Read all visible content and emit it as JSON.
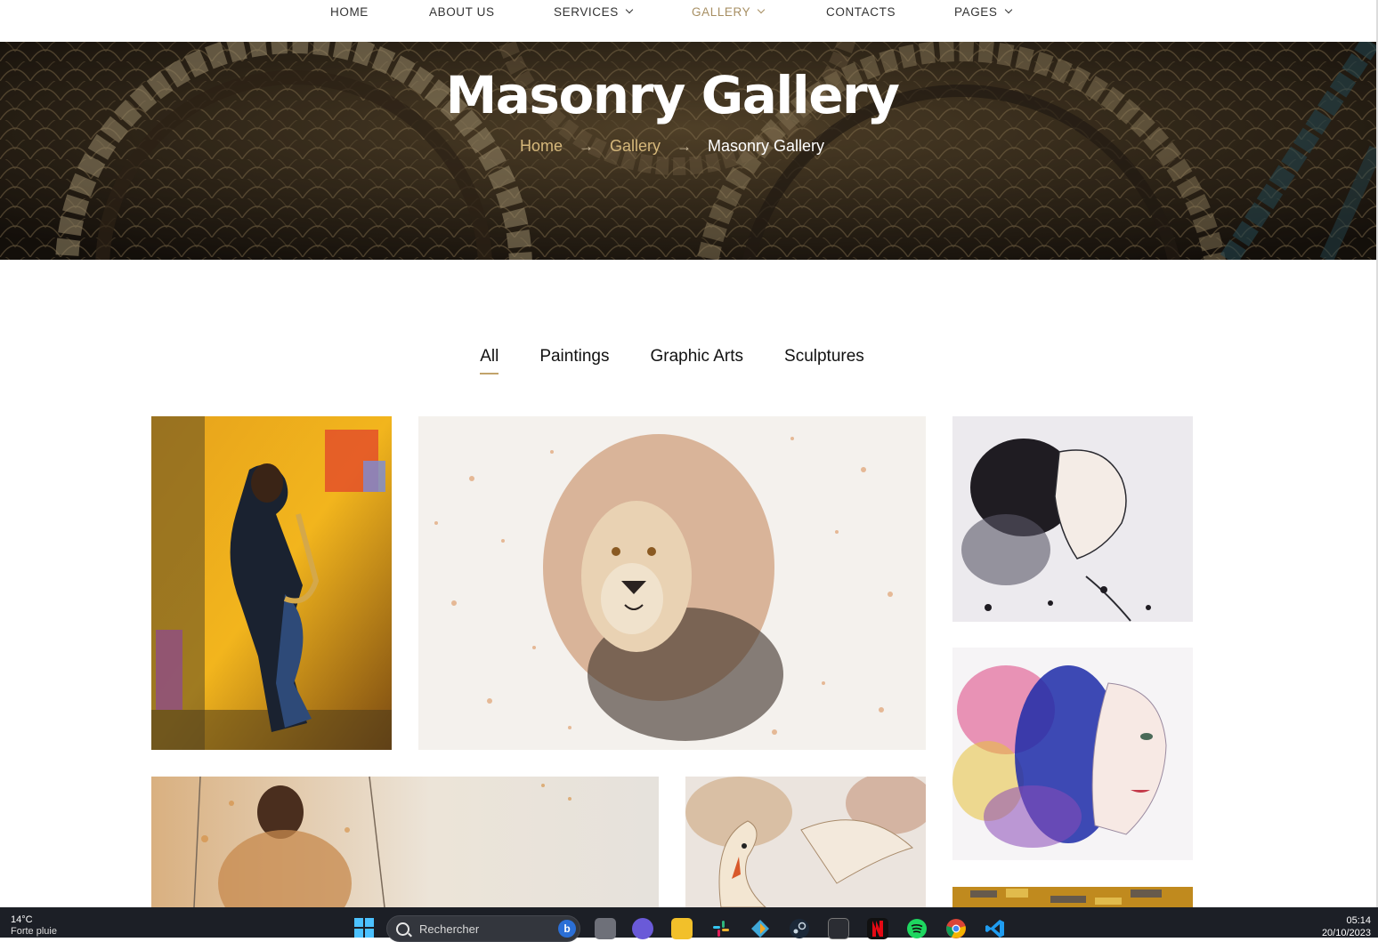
{
  "nav": {
    "items": [
      {
        "label": "HOME",
        "dropdown": false,
        "active": false
      },
      {
        "label": "ABOUT US",
        "dropdown": false,
        "active": false
      },
      {
        "label": "SERVICES",
        "dropdown": true,
        "active": false
      },
      {
        "label": "GALLERY",
        "dropdown": true,
        "active": true
      },
      {
        "label": "CONTACTS",
        "dropdown": false,
        "active": false
      },
      {
        "label": "PAGES",
        "dropdown": true,
        "active": false
      }
    ],
    "active_color": "#a78f63"
  },
  "hero": {
    "title": "Masonry Gallery",
    "breadcrumb": {
      "home": "Home",
      "gallery": "Gallery",
      "current": "Masonry Gallery",
      "separator": "→"
    },
    "link_color": "#d6b87b"
  },
  "filters": {
    "items": [
      "All",
      "Paintings",
      "Graphic Arts",
      "Sculptures"
    ],
    "active": "All",
    "underline_color": "#c2a36a"
  },
  "gallery": {
    "tiles": [
      {
        "subject": "saxophone-player-painting"
      },
      {
        "subject": "lion-watercolor"
      },
      {
        "subject": "woman-profile-ink"
      },
      {
        "subject": "woman-blue-watercolor"
      },
      {
        "subject": "woman-back-watercolor"
      },
      {
        "subject": "swan-watercolor"
      },
      {
        "subject": "golden-mosaic-painting"
      }
    ]
  },
  "taskbar": {
    "temperature": "14°C",
    "weather": "Forte pluie",
    "search_placeholder": "Rechercher",
    "time": "05:14",
    "date": "20/10/2023",
    "icons": [
      "windows-start-icon",
      "task-view-icon",
      "teams-icon",
      "file-explorer-icon",
      "slack-icon",
      "git-icon",
      "steam-icon",
      "terminal-icon",
      "netflix-icon",
      "spotify-icon",
      "chrome-icon",
      "vscode-icon"
    ]
  }
}
